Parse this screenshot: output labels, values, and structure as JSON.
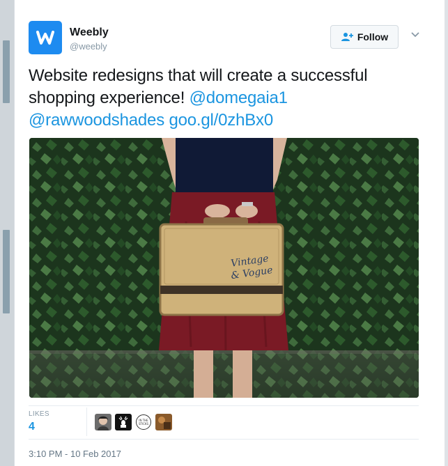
{
  "account": {
    "name": "Weebly",
    "handle": "@weebly",
    "avatar_icon": "weebly-logo-icon",
    "brand_color": "#1d8bf0"
  },
  "follow_button": {
    "label": "Follow",
    "icon": "add-user-icon"
  },
  "menu_icon": "chevron-down-icon",
  "tweet": {
    "text_plain": "Website redesigns that will create a successful shopping experience!",
    "mention_1": "@domegaia1",
    "mention_2": "@rawwoodshades",
    "link": "goo.gl/0zhBx0",
    "link_color": "#1b95e0"
  },
  "media": {
    "suitcase_text_line1": "Vintage",
    "suitcase_text_line2": "& Vogue"
  },
  "stats": {
    "likes_label": "LIKES",
    "likes_count": "4",
    "likers": [
      {
        "name": "liker-avatar-person"
      },
      {
        "name": "liker-avatar-deer"
      },
      {
        "name": "liker-avatar-in-the-sticks",
        "text": "IN THE STICKS"
      },
      {
        "name": "liker-avatar-photo"
      }
    ]
  },
  "timestamp": "3:10 PM - 10 Feb 2017"
}
